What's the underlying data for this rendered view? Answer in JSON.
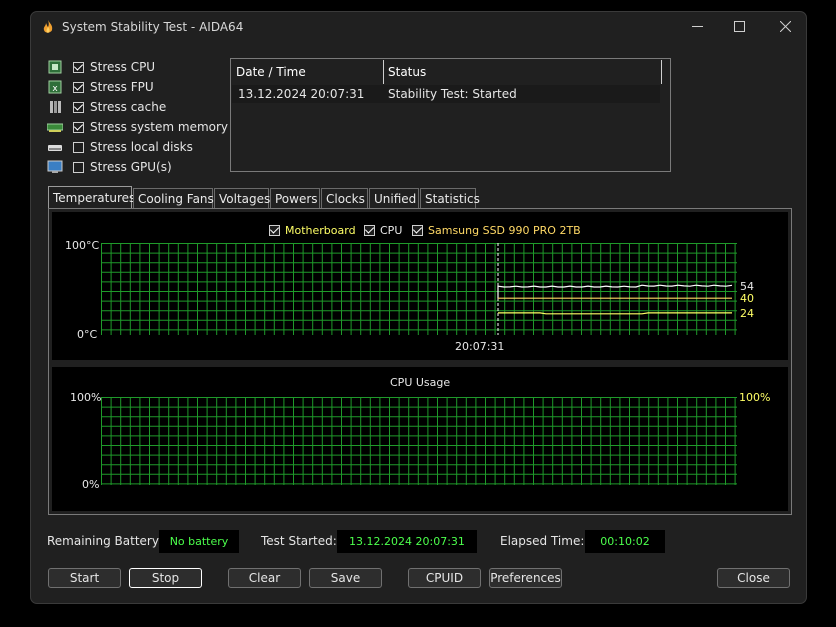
{
  "window": {
    "title": "System Stability Test - AIDA64"
  },
  "stress_options": [
    {
      "label": "Stress CPU",
      "checked": true,
      "icon": "cpu-chip-icon"
    },
    {
      "label": "Stress FPU",
      "checked": true,
      "icon": "fpu-chip-icon"
    },
    {
      "label": "Stress cache",
      "checked": true,
      "icon": "cache-icon"
    },
    {
      "label": "Stress system memory",
      "checked": true,
      "icon": "memory-module-icon"
    },
    {
      "label": "Stress local disks",
      "checked": false,
      "icon": "disk-drive-icon"
    },
    {
      "label": "Stress GPU(s)",
      "checked": false,
      "icon": "gpu-monitor-icon"
    }
  ],
  "status_table": {
    "headers": [
      "Date / Time",
      "Status"
    ],
    "rows": [
      {
        "datetime": "13.12.2024 20:07:31",
        "status": "Stability Test: Started"
      }
    ]
  },
  "tabs": [
    "Temperatures",
    "Cooling Fans",
    "Voltages",
    "Powers",
    "Clocks",
    "Unified",
    "Statistics"
  ],
  "active_tab": "Temperatures",
  "temp_chart": {
    "legend": [
      {
        "label": "Motherboard",
        "checked": true,
        "color": "#ffff66"
      },
      {
        "label": "CPU",
        "checked": true,
        "color": "#e8e8e8"
      },
      {
        "label": "Samsung SSD 990 PRO 2TB",
        "checked": true,
        "color": "#ffd966"
      }
    ],
    "y_max_label": "100°C",
    "y_min_label": "0°C",
    "marker_time": "20:07:31",
    "readouts": [
      {
        "value": "54",
        "color": "#e8e8e8"
      },
      {
        "value": "40",
        "color": "#ffff66"
      },
      {
        "value": "24",
        "color": "#ffff66"
      }
    ]
  },
  "chart_data": [
    {
      "type": "line",
      "title": "",
      "ylim": [
        0,
        100
      ],
      "y_unit": "°C",
      "x_marker": "20:07:31",
      "series": [
        {
          "name": "CPU",
          "color": "#ffffff",
          "current": 54
        },
        {
          "name": "Samsung SSD 990 PRO 2TB",
          "color": "#ffd966",
          "current": 40
        },
        {
          "name": "Motherboard",
          "color": "#ffff66",
          "current": 24
        }
      ]
    },
    {
      "type": "line",
      "title": "CPU Usage",
      "ylim": [
        0,
        100
      ],
      "y_unit": "%",
      "series": [
        {
          "name": "",
          "color": "#ffff66",
          "current": 100
        }
      ]
    }
  ],
  "usage_chart": {
    "title": "CPU Usage",
    "y_max_label": "100%",
    "y_min_label": "0%",
    "readout": "100%"
  },
  "info": {
    "battery_label": "Remaining Battery:",
    "battery_value": "No battery",
    "started_label": "Test Started:",
    "started_value": "13.12.2024 20:07:31",
    "elapsed_label": "Elapsed Time:",
    "elapsed_value": "00:10:02"
  },
  "buttons": {
    "start": "Start",
    "stop": "Stop",
    "clear": "Clear",
    "save": "Save",
    "cpuid": "CPUID",
    "preferences": "Preferences",
    "close": "Close"
  }
}
